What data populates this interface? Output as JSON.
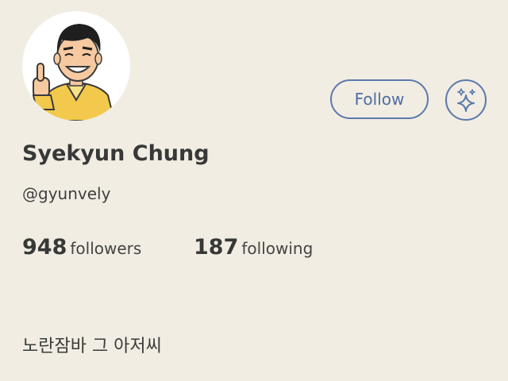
{
  "profile": {
    "display_name": "Syekyun Chung",
    "handle": "@gyunvely",
    "bio": "노란잠바 그 아저씨",
    "avatar_icon": "cartoon-portrait-thumbs-up"
  },
  "stats": {
    "followers_count": "948",
    "followers_label": "followers",
    "following_count": "187",
    "following_label": "following"
  },
  "actions": {
    "follow_label": "Follow",
    "sparkle_icon": "sparkle-icon"
  },
  "colors": {
    "background": "#f1ede2",
    "accent": "#5b78ad",
    "text": "#383838",
    "jacket": "#f2c94c"
  }
}
